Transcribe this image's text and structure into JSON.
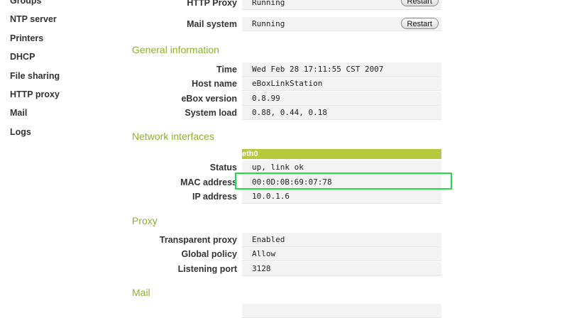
{
  "sidebar": {
    "items": [
      {
        "label": "Groups"
      },
      {
        "label": "NTP server"
      },
      {
        "label": "Printers"
      },
      {
        "label": "DHCP"
      },
      {
        "label": "File sharing"
      },
      {
        "label": "HTTP proxy"
      },
      {
        "label": "Mail"
      },
      {
        "label": "Logs"
      }
    ]
  },
  "services": {
    "rows": [
      {
        "label": "HTTP Proxy",
        "value": "Running",
        "button": "Restart"
      },
      {
        "label": "Mail system",
        "value": "Running",
        "button": "Restart"
      }
    ]
  },
  "general": {
    "title": "General information",
    "rows": [
      {
        "label": "Time",
        "value": "Wed Feb 28 17:11:55 CST 2007"
      },
      {
        "label": "Host name",
        "value": "eBoxLinkStation"
      },
      {
        "label": "eBox version",
        "value": "0.8.99"
      },
      {
        "label": "System load",
        "value": "0.88, 0.44, 0.18"
      }
    ]
  },
  "network": {
    "title": "Network interfaces",
    "interface": "eth0",
    "rows": [
      {
        "label": "Status",
        "value": "up, link ok"
      },
      {
        "label": "MAC address",
        "value": "00:0D:0B:69:07:78"
      },
      {
        "label": "IP address",
        "value": "10.0.1.6"
      }
    ]
  },
  "proxy": {
    "title": "Proxy",
    "rows": [
      {
        "label": "Transparent proxy",
        "value": "Enabled"
      },
      {
        "label": "Global policy",
        "value": "Allow"
      },
      {
        "label": "Listening port",
        "value": "3128"
      }
    ]
  },
  "mail": {
    "title": "Mail"
  },
  "colors": {
    "section_title": "#8cb02c",
    "interface_header": "#b6c93a",
    "highlight_border": "#22dd44"
  }
}
